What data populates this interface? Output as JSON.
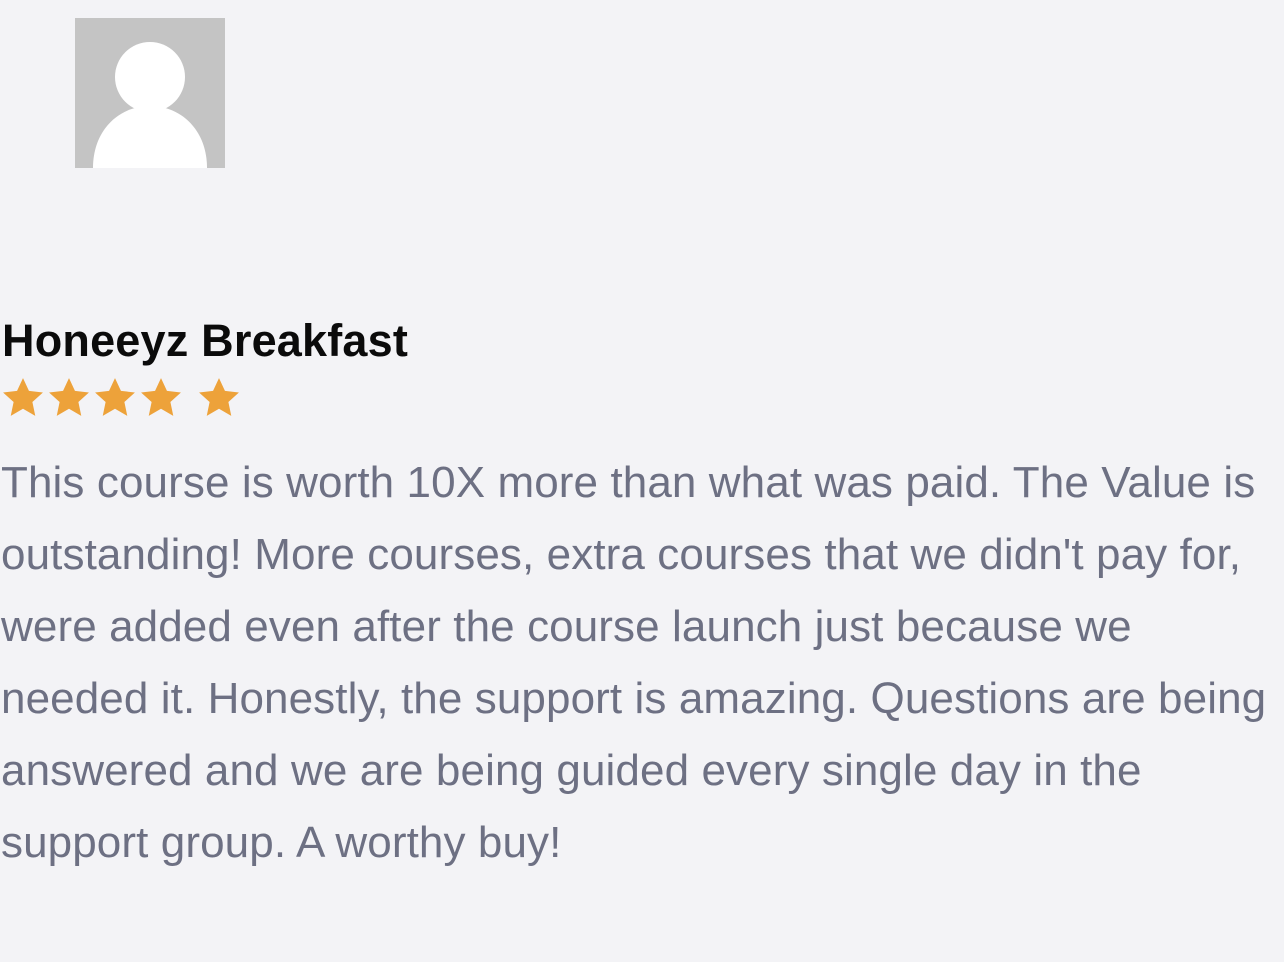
{
  "review": {
    "avatar_icon": "default-user-avatar-icon",
    "reviewer_name": "Honeeyz Breakfast",
    "rating": 5,
    "rating_max": 5,
    "star_color": "#eda23a",
    "text": "This course is worth 10X more than what was paid. The Value is outstanding! More courses, extra courses that we didn't pay for, were added even after the course launch just because we needed it. Honestly, the support is amazing. Questions are being answered and we are being guided every single day in the support group. A worthy buy!",
    "text_color": "#6d7083",
    "name_color": "#0b0b0b"
  }
}
